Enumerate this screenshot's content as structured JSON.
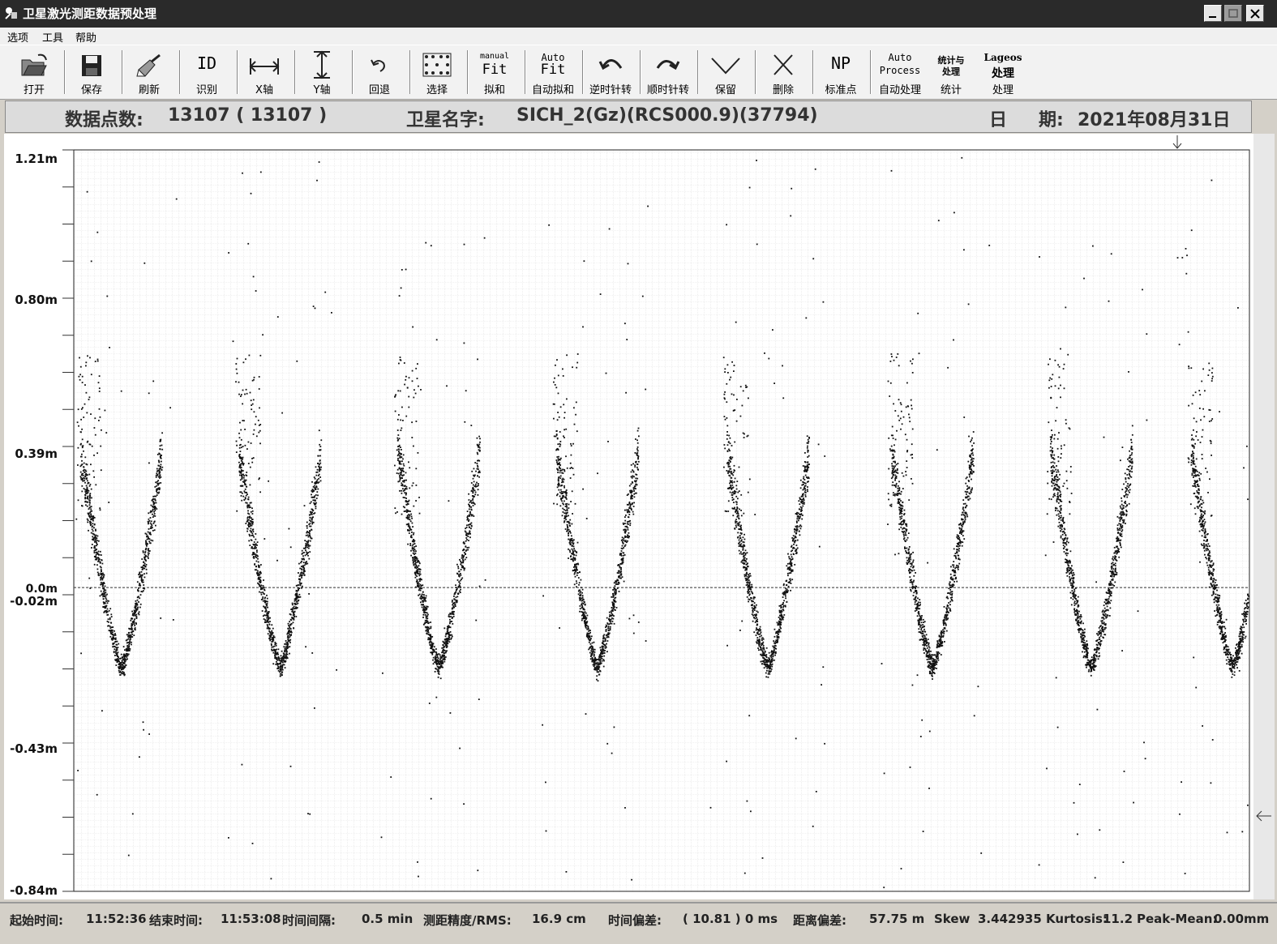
{
  "window": {
    "title": "卫星激光测距数据预处理"
  },
  "menu": [
    "选项",
    "工具",
    "帮助"
  ],
  "toolbar": [
    {
      "icon": "open-folder-icon",
      "label": "打开"
    },
    {
      "icon": "save-disk-icon",
      "label": "保存"
    },
    {
      "icon": "brush-icon",
      "label": "刷新"
    },
    {
      "icon": "id-icon",
      "label": "识别",
      "glyph": "ID"
    },
    {
      "icon": "horizontal-arrows-icon",
      "label": "X轴"
    },
    {
      "icon": "vertical-arrows-icon",
      "label": "Y轴"
    },
    {
      "icon": "undo-icon",
      "label": "回退"
    },
    {
      "icon": "select-dots-icon",
      "label": "选择"
    },
    {
      "icon": "manual-fit-icon",
      "label": "拟和",
      "glyph_small": "manual",
      "glyph": "Fit"
    },
    {
      "icon": "auto-fit-icon",
      "label": "自动拟和",
      "glyph_small": "Auto",
      "glyph": "Fit"
    },
    {
      "icon": "rotate-ccw-icon",
      "label": "逆时针转"
    },
    {
      "icon": "rotate-cw-icon",
      "label": "顺时针转"
    },
    {
      "icon": "check-keep-icon",
      "label": "保留"
    },
    {
      "icon": "x-delete-icon",
      "label": "删除"
    },
    {
      "icon": "np-icon",
      "label": "标准点",
      "glyph": "NP"
    },
    {
      "icon": "auto-process-icon",
      "label": "自动处理",
      "glyph_small": "Auto",
      "glyph": "Process"
    },
    {
      "icon": "stats-icon",
      "label": "统计",
      "glyph_small": "统计与",
      "glyph": "处理"
    },
    {
      "icon": "lageos-icon",
      "label": "处理",
      "glyph_small": "Lageos",
      "glyph": "处理"
    }
  ],
  "info": {
    "points_label": "数据点数:",
    "points_value": "13107 ( 13107 )",
    "satellite_label": "卫星名字:",
    "satellite_value": "SICH_2(Gz)(RCS000.9)(37794)",
    "date_label1": "日",
    "date_label2": "期:",
    "date_value": "2021年08月31日"
  },
  "chart_data": {
    "type": "scatter",
    "y_tick_labels": [
      "1.21m",
      "0.80m",
      "0.39m",
      "0.0m",
      "-0.02m",
      "-0.43m",
      "-0.84m"
    ],
    "ylim": [
      -0.84,
      1.21
    ],
    "zero_line": 0.0,
    "grid": true,
    "n_points": 13107,
    "pattern": "periodic V-shaped residual arcs",
    "arc_count": 8,
    "arc_centers_fraction": [
      0.04,
      0.175,
      0.31,
      0.445,
      0.59,
      0.73,
      0.865,
      0.985
    ],
    "arc_minimum_m": -0.22,
    "arc_top_m": 0.38
  },
  "status": {
    "start_label": "起始时间:",
    "start_value": "11:52:36",
    "end_label": "结束时间:",
    "end_value": "11:53:08",
    "interval_label": "时间间隔:",
    "interval_value": "0.5 min",
    "rms_label": "测距精度/RMS:",
    "rms_value": "16.9 cm",
    "time_bias_label": "时间偏差:",
    "time_bias_value": "( 10.81 ) 0 ms",
    "range_bias_label": "距离偏差:",
    "range_bias_value": "57.75 m",
    "skew_label": "Skew",
    "skew_value": "3.442935",
    "kurtosis_label": "Kurtosis:",
    "kurtosis_value": "11.2",
    "peak_label": "Peak-Mean:",
    "peak_value": "0.00mm"
  }
}
